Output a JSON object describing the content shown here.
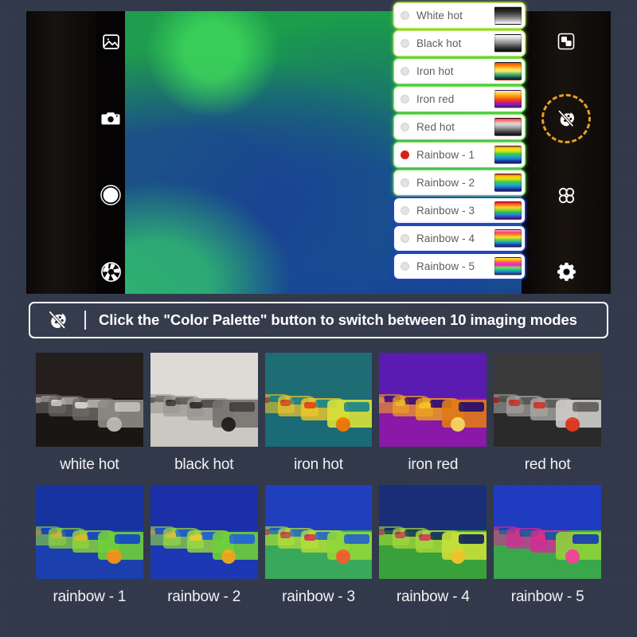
{
  "camera": {
    "left_tools": [
      {
        "name": "gallery-icon",
        "label": "Gallery"
      },
      {
        "name": "camera-icon",
        "label": "Camera"
      },
      {
        "name": "shutter-button",
        "label": "Shutter"
      },
      {
        "name": "aperture-icon",
        "label": "Aperture"
      }
    ],
    "right_tools": [
      {
        "name": "picture-in-picture-icon",
        "label": "Picture in picture"
      },
      {
        "name": "color-palette-icon",
        "label": "Color Palette"
      },
      {
        "name": "grid-apps-icon",
        "label": "Modes"
      },
      {
        "name": "settings-gear-icon",
        "label": "Settings"
      }
    ],
    "highlight_ring_color": "#e8a020"
  },
  "palette_list": [
    {
      "label": "White hot",
      "selected": false,
      "glow": "ylw",
      "swatch": "white-hot"
    },
    {
      "label": "Black hot",
      "selected": false,
      "glow": "ylw",
      "swatch": "black-hot"
    },
    {
      "label": "Iron hot",
      "selected": false,
      "glow": "green",
      "swatch": "iron-hot"
    },
    {
      "label": "Iron red",
      "selected": false,
      "glow": "green",
      "swatch": "iron-red"
    },
    {
      "label": "Red hot",
      "selected": false,
      "glow": "green",
      "swatch": "red-hot"
    },
    {
      "label": "Rainbow - 1",
      "selected": true,
      "glow": "green",
      "swatch": "rainbow-1"
    },
    {
      "label": "Rainbow - 2",
      "selected": false,
      "glow": "green",
      "swatch": "rainbow-2"
    },
    {
      "label": "Rainbow - 3",
      "selected": false,
      "glow": "blue",
      "swatch": "rainbow-3"
    },
    {
      "label": "Rainbow - 4",
      "selected": false,
      "glow": "blue",
      "swatch": "rainbow-4"
    },
    {
      "label": "Rainbow - 5",
      "selected": false,
      "glow": "blue",
      "swatch": "rainbow-5"
    }
  ],
  "banner": {
    "icon": "color-palette-icon",
    "text": "Click the \"Color Palette\" button to switch between 10 imaging modes"
  },
  "thumbnails": [
    {
      "caption": "white hot",
      "mode": "white-hot"
    },
    {
      "caption": "black hot",
      "mode": "black-hot"
    },
    {
      "caption": "iron hot",
      "mode": "iron-hot"
    },
    {
      "caption": "iron red",
      "mode": "iron-red"
    },
    {
      "caption": "red hot",
      "mode": "red-hot"
    },
    {
      "caption": "rainbow - 1",
      "mode": "rainbow-1"
    },
    {
      "caption": "rainbow - 2",
      "mode": "rainbow-2"
    },
    {
      "caption": "rainbow - 3",
      "mode": "rainbow-3"
    },
    {
      "caption": "rainbow - 4",
      "mode": "rainbow-4"
    },
    {
      "caption": "rainbow - 5",
      "mode": "rainbow-5"
    }
  ],
  "colors": {
    "page_background": "#31384a",
    "banner_border": "#ffffff",
    "selected_radio": "#d8201a",
    "list_text": "#5d5d5d"
  }
}
